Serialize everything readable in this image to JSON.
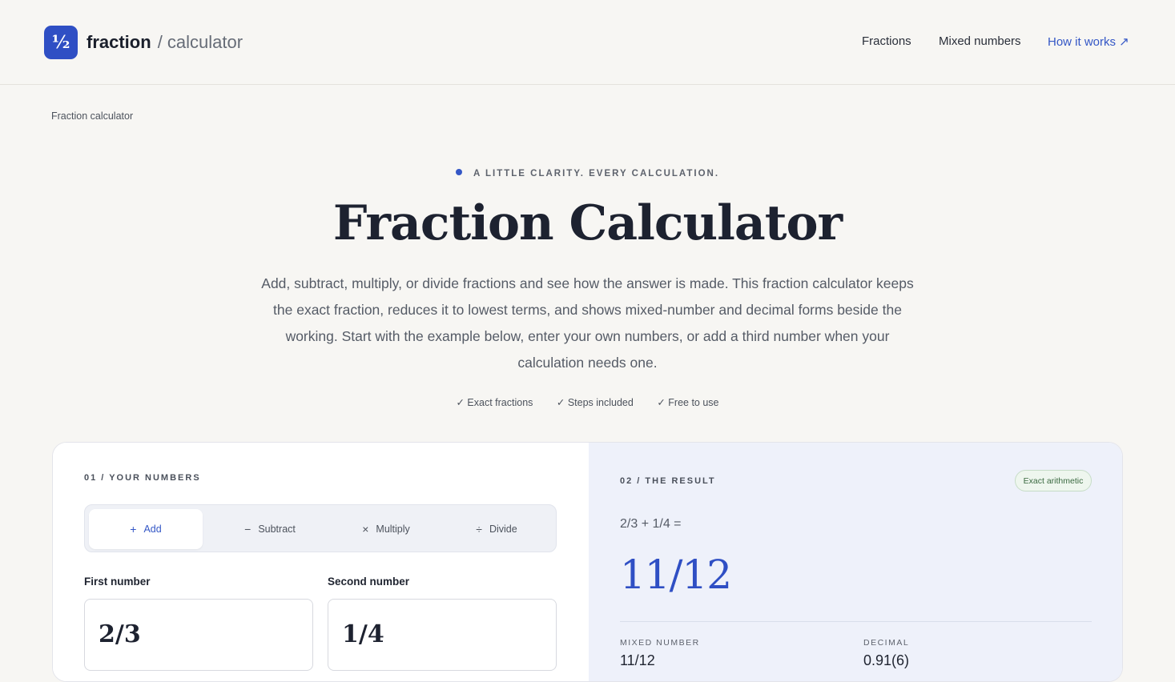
{
  "header": {
    "logo_glyph": "½",
    "brand_name": "fraction",
    "brand_suffix": "/ calculator",
    "nav": {
      "fractions": "Fractions",
      "mixed_numbers": "Mixed numbers",
      "how_it_works": "How it works ↗"
    }
  },
  "breadcrumb": "Fraction calculator",
  "hero": {
    "eyebrow": "A LITTLE CLARITY. EVERY CALCULATION.",
    "title": "Fraction Calculator",
    "description": "Add, subtract, multiply, or divide fractions and see how the answer is made. This fraction calculator keeps the exact fraction, reduces it to lowest terms, and shows mixed-number and decimal forms beside the working. Start with the example below, enter your own numbers, or add a third number when your calculation needs one.",
    "checks": [
      "✓ Exact fractions",
      "✓ Steps included",
      "✓ Free to use"
    ]
  },
  "input_panel": {
    "label": "01 / YOUR NUMBERS",
    "operations": [
      {
        "symbol": "+",
        "label": "Add",
        "active": true
      },
      {
        "symbol": "−",
        "label": "Subtract",
        "active": false
      },
      {
        "symbol": "×",
        "label": "Multiply",
        "active": false
      },
      {
        "symbol": "÷",
        "label": "Divide",
        "active": false
      }
    ],
    "first_label": "First number",
    "first_value": "2/3",
    "second_label": "Second number",
    "second_value": "1/4"
  },
  "result_panel": {
    "label": "02 / THE RESULT",
    "badge": "Exact arithmetic",
    "expression": "2/3 + 1/4 =",
    "result": "11/12",
    "mixed_label": "MIXED NUMBER",
    "mixed_value": "11/12",
    "decimal_label": "DECIMAL",
    "decimal_value": "0.91(6)"
  },
  "colors": {
    "accent": "#2f4fc4",
    "background": "#f7f6f3",
    "result_bg": "#eef1fa",
    "badge_green": "#3b6a41"
  }
}
